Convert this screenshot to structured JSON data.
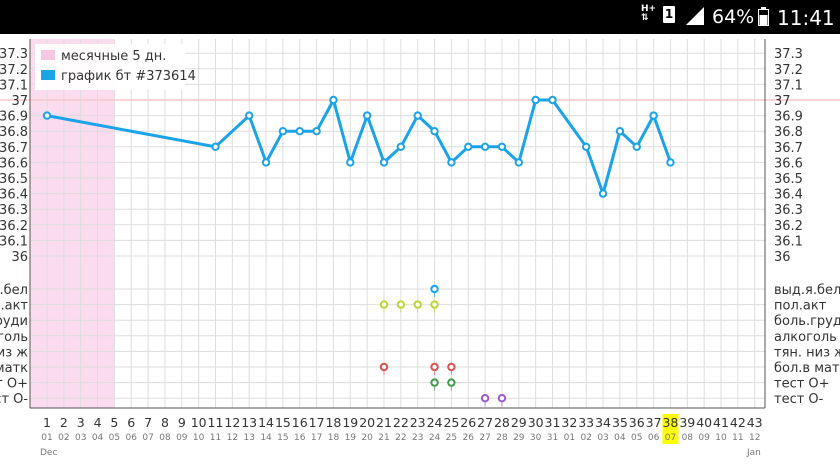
{
  "status_bar": {
    "network": "H+",
    "sim_slot": "1",
    "signal_icon": "signal-icon",
    "battery_percent": "64%",
    "battery_icon": "battery-icon",
    "time": "11:41"
  },
  "colors": {
    "temperature_line": "#1aa3e8",
    "menses_band": "#fbdcef",
    "legend_menses_swatch": "#f8c8e3",
    "legend_series_swatch": "#1aa3e8",
    "reference_line": "#f8c6c6",
    "highlight_day": "#ffff00",
    "marker_yellow": "#b9d831",
    "marker_red": "#d9534f",
    "marker_green": "#3d9a48",
    "marker_purple": "#9b59d0",
    "marker_blue": "#1aa3e8",
    "grid": "#dddddd"
  },
  "chart_data": {
    "type": "line",
    "legend": [
      {
        "label": "месячные 5 дн.",
        "swatch": "pink"
      },
      {
        "label": "график бт #373614",
        "swatch": "blue"
      }
    ],
    "legend_placement": "top-left",
    "grid": true,
    "y_ticks": [
      "37.3",
      "37.2",
      "37.1",
      "37",
      "36.9",
      "36.8",
      "36.7",
      "36.6",
      "36.5",
      "36.4",
      "36.3",
      "36.2",
      "36.1",
      "36"
    ],
    "ylim": [
      36,
      37.3
    ],
    "reference_value": 37,
    "menses_days": [
      1,
      5
    ],
    "days": [
      "1",
      "2",
      "3",
      "4",
      "5",
      "6",
      "7",
      "8",
      "9",
      "10",
      "11",
      "12",
      "13",
      "14",
      "15",
      "16",
      "17",
      "18",
      "19",
      "20",
      "21",
      "22",
      "23",
      "24",
      "25",
      "26",
      "27",
      "28",
      "29",
      "30",
      "31",
      "32",
      "33",
      "34",
      "35",
      "36",
      "37",
      "38",
      "39",
      "40",
      "41",
      "42",
      "43"
    ],
    "dates": [
      "01",
      "02",
      "03",
      "04",
      "05",
      "06",
      "07",
      "08",
      "09",
      "10",
      "11",
      "12",
      "13",
      "14",
      "15",
      "16",
      "17",
      "18",
      "19",
      "20",
      "21",
      "22",
      "23",
      "24",
      "25",
      "26",
      "27",
      "28",
      "29",
      "30",
      "31",
      "01",
      "02",
      "03",
      "04",
      "05",
      "06",
      "07",
      "08",
      "09",
      "10",
      "11",
      "12"
    ],
    "highlight_day": 38,
    "month_start": "Dec",
    "month_end": "Jan",
    "series": [
      {
        "name": "график бт #373614",
        "points": [
          [
            1,
            36.9
          ],
          [
            11,
            36.7
          ],
          [
            13,
            36.9
          ],
          [
            14,
            36.6
          ],
          [
            15,
            36.8
          ],
          [
            16,
            36.8
          ],
          [
            17,
            36.8
          ],
          [
            18,
            37.0
          ],
          [
            19,
            36.6
          ],
          [
            20,
            36.9
          ],
          [
            21,
            36.6
          ],
          [
            22,
            36.7
          ],
          [
            23,
            36.9
          ],
          [
            24,
            36.8
          ],
          [
            25,
            36.6
          ],
          [
            26,
            36.7
          ],
          [
            27,
            36.7
          ],
          [
            28,
            36.7
          ],
          [
            29,
            36.6
          ],
          [
            30,
            37.0
          ],
          [
            31,
            37.0
          ],
          [
            33,
            36.7
          ],
          [
            34,
            36.4
          ],
          [
            35,
            36.8
          ],
          [
            36,
            36.7
          ],
          [
            37,
            36.9
          ],
          [
            38,
            36.6
          ]
        ]
      }
    ],
    "symptom_rows": [
      {
        "left": "ыд.я.бел",
        "right": "выд.я.бел",
        "color": "blue",
        "days": [
          24
        ]
      },
      {
        "left": "пол.акт",
        "right": "пол.акт",
        "color": "yellow",
        "days": [
          21,
          22,
          23,
          24
        ]
      },
      {
        "left": "ль.груди",
        "right": "боль.груди",
        "color": "",
        "days": []
      },
      {
        "left": "алкоголь",
        "right": "алкоголь",
        "color": "",
        "days": []
      },
      {
        "left": "н. низ ж",
        "right": "тян. низ ж",
        "color": "",
        "days": []
      },
      {
        "left": "бол.в матк",
        "right": "бол.в матк",
        "color": "red",
        "days": [
          21,
          24,
          25
        ]
      },
      {
        "left": "тест О+",
        "right": "тест О+",
        "color": "green",
        "days": [
          24,
          25
        ]
      },
      {
        "left": "тест О-",
        "right": "тест О-",
        "color": "purple",
        "days": [
          27,
          28
        ]
      }
    ]
  }
}
